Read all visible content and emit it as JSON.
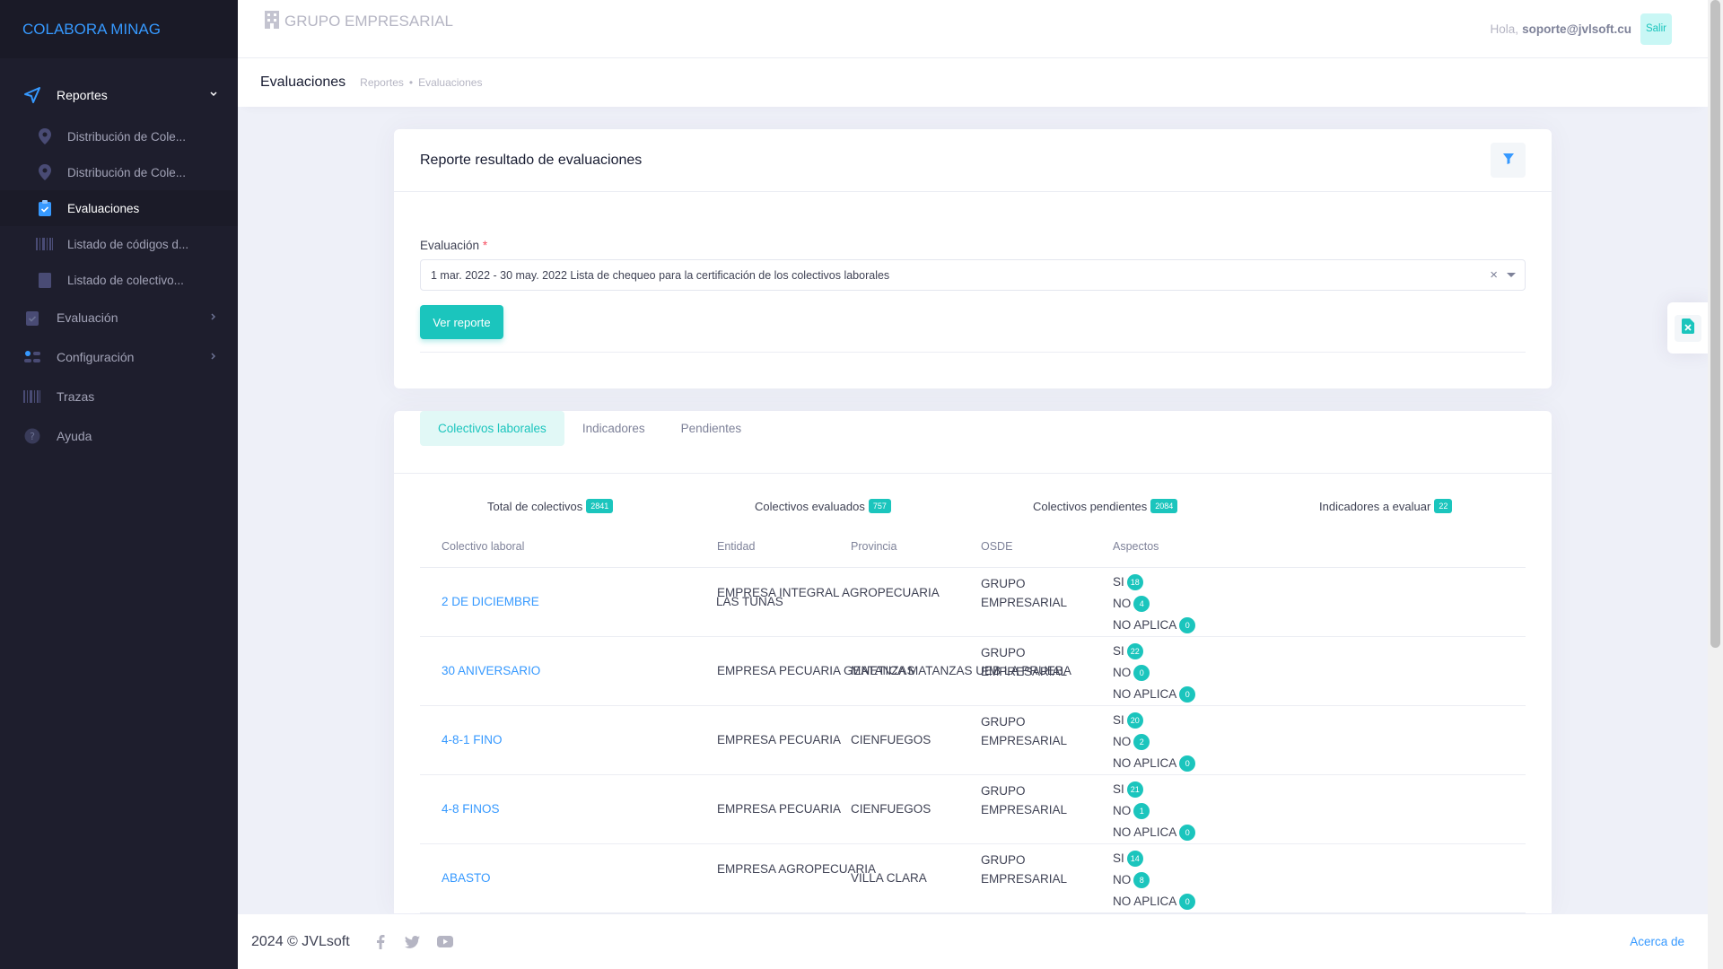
{
  "brand": "COLABORA MINAG",
  "header": {
    "org_name": "GRUPO EMPRESARIAL",
    "greeting": "Hola,",
    "user_email": "soporte@jvlsoft.cu",
    "logout_label": "Salir"
  },
  "sidebar": {
    "reportes": "Reportes",
    "sub": [
      "Distribución de Cole...",
      "Distribución de Cole...",
      "Evaluaciones",
      "Listado de códigos d...",
      "Listado de colectivo..."
    ],
    "evaluacion": "Evaluación",
    "configuracion": "Configuración",
    "trazas": "Trazas",
    "ayuda": "Ayuda"
  },
  "subheader": {
    "title": "Evaluaciones",
    "breadcrumb": [
      "Reportes",
      "Evaluaciones"
    ]
  },
  "report": {
    "title": "Reporte resultado de evaluaciones",
    "field_label": "Evaluación",
    "required_mark": "*",
    "selected_value": "1 mar. 2022 - 30 may. 2022 Lista de chequeo para la certificación de los colectivos laborales",
    "clear_symbol": "×",
    "submit_label": "Ver reporte"
  },
  "tabs": [
    "Colectivos laborales",
    "Indicadores",
    "Pendientes"
  ],
  "stats": [
    {
      "label": "Total de colectivos",
      "value": "2841"
    },
    {
      "label": "Colectivos evaluados",
      "value": "757"
    },
    {
      "label": "Colectivos pendientes",
      "value": "2084"
    },
    {
      "label": "Indicadores a evaluar",
      "value": "22"
    }
  ],
  "table": {
    "headers": [
      "Colectivo laboral",
      "Entidad",
      "Provincia",
      "OSDE",
      "Aspectos"
    ],
    "aspect_labels": [
      "SI",
      "NO",
      "NO APLICA"
    ],
    "rows": [
      {
        "colectivo": "2 DE DICIEMBRE",
        "entidad": "EMPRESA INTEGRAL AGROPECUARIA",
        "provincia": "LAS TUNAS",
        "osde1": "GRUPO",
        "osde2": "EMPRESARIAL",
        "si": "18",
        "no": "4",
        "na": "0"
      },
      {
        "colectivo": "30 ANIVERSARIO",
        "entidad": "EMPRESA PECUARIA GENETICA MATANZAS UEB LA PRUEBA",
        "provincia": "MATANZAS",
        "osde1": "GRUPO",
        "osde2": "EMPRESARIAL",
        "si": "22",
        "no": "0",
        "na": "0"
      },
      {
        "colectivo": "4-8-1 FINO",
        "entidad": "EMPRESA PECUARIA",
        "provincia": "CIENFUEGOS",
        "osde1": "GRUPO",
        "osde2": "EMPRESARIAL",
        "si": "20",
        "no": "2",
        "na": "0"
      },
      {
        "colectivo": "4-8 FINOS",
        "entidad": "EMPRESA PECUARIA",
        "provincia": "CIENFUEGOS",
        "osde1": "GRUPO",
        "osde2": "EMPRESARIAL",
        "si": "21",
        "no": "1",
        "na": "0"
      },
      {
        "colectivo": "ABASTO",
        "entidad": "EMPRESA AGROPECUARIA",
        "provincia": "VILLA CLARA",
        "osde1": "GRUPO",
        "osde2": "EMPRESARIAL",
        "si": "14",
        "no": "8",
        "na": "0"
      }
    ]
  },
  "footer": {
    "copyright": "2024 © JVLsoft",
    "about": "Acerca de"
  },
  "icons": {
    "social": [
      "facebook-icon",
      "twitter-icon",
      "youtube-icon"
    ],
    "export": "excel-icon",
    "filter": "filter-icon"
  },
  "colors": {
    "primary": "#3699ff",
    "accent": "#1bc5bd",
    "sidebar_bg": "#1e1e2d"
  }
}
